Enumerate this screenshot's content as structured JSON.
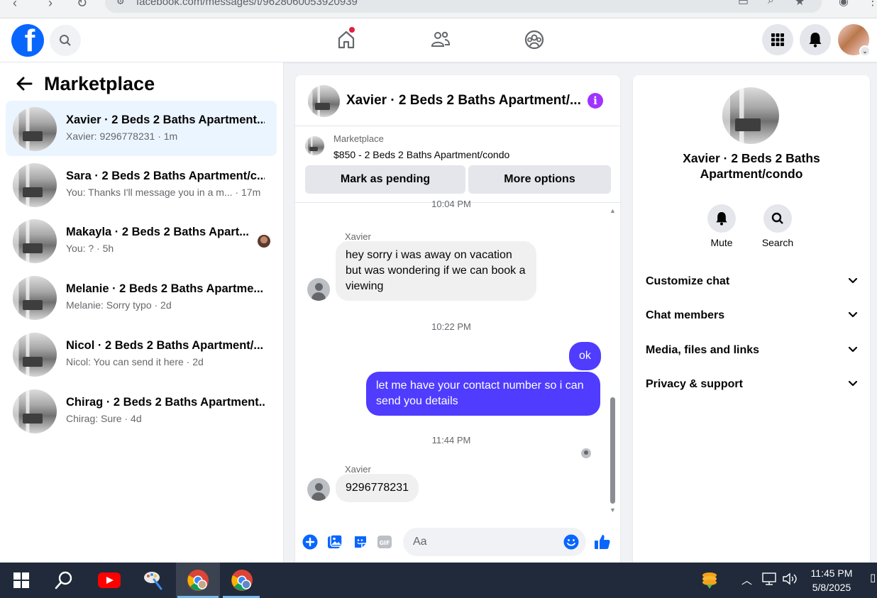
{
  "browser": {
    "url": "facebook.com/messages/t/9628060053920939"
  },
  "header": {
    "logo": "f",
    "search_icon": "search-icon",
    "nav": [
      "home-icon",
      "friends-icon",
      "groups-icon"
    ],
    "right": [
      "menu-grid-icon",
      "bell-icon",
      "profile-avatar"
    ]
  },
  "marketplace": {
    "title": "Marketplace",
    "conversations": [
      {
        "name": "Xavier · 2 Beds 2 Baths Apartment...",
        "sub": "Xavier: 9296778231 · 1m"
      },
      {
        "name": "Sara · 2 Beds 2 Baths Apartment/c...",
        "sub": "You: Thanks I'll message you in a m...  · 17m"
      },
      {
        "name": "Makayla · 2 Beds 2 Baths Apart...",
        "sub": "You: ? · 5h"
      },
      {
        "name": "Melanie · 2 Beds 2 Baths Apartme...",
        "sub": "Melanie: Sorry typo · 2d"
      },
      {
        "name": "Nicol · 2 Beds 2 Baths Apartment/...",
        "sub": "Nicol: You can send it here · 2d"
      },
      {
        "name": "Chirag · 2 Beds 2 Baths Apartment...",
        "sub": "Chirag: Sure · 4d"
      }
    ]
  },
  "chat": {
    "title": "Xavier · 2 Beds 2 Baths Apartment/...",
    "listing_label": "Marketplace",
    "listing_price": "$850 - 2 Beds 2 Baths Apartment/condo",
    "btn_pending": "Mark as pending",
    "btn_more": "More options",
    "time_top": "10:04 PM",
    "sender1": "Xavier",
    "msg1": "hey sorry i was away on vacation but was wondering if we can book a viewing",
    "time2": "10:22 PM",
    "msg2": "ok",
    "msg3": "let me have your contact number so i can send you details",
    "time3": "11:44 PM",
    "sender2": "Xavier",
    "msg4": "9296778231",
    "composer_placeholder": "Aa"
  },
  "info": {
    "name": "Xavier · 2 Beds 2 Baths Apartment/condo",
    "mute": "Mute",
    "search": "Search",
    "sections": [
      "Customize chat",
      "Chat members",
      "Media, files and links",
      "Privacy & support"
    ]
  },
  "taskbar": {
    "time": "11:45 PM",
    "date": "5/8/2025"
  },
  "colors": {
    "brand": "#0866ff",
    "outgoing_bubble": "#4f3cff",
    "active_conv": "#ebf5ff",
    "info_icon": "#a033ff"
  }
}
